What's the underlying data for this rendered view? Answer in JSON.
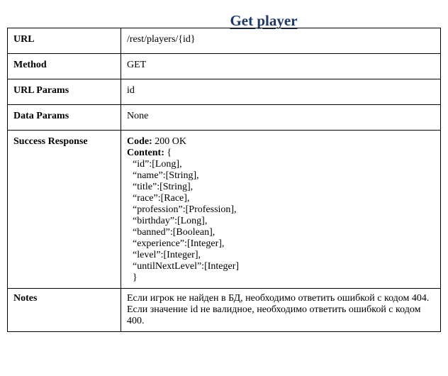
{
  "title": "Get player",
  "rows": {
    "url": {
      "key": "URL",
      "value": "/rest/players/{id}"
    },
    "method": {
      "key": "Method",
      "value": "GET"
    },
    "url_params": {
      "key": "URL Params",
      "value": "id"
    },
    "data_params": {
      "key": "Data Params",
      "value": "None"
    },
    "success": {
      "key": "Success Response",
      "code_label": "Code:",
      "code_value": " 200 OK",
      "content_label": "Content:",
      "content_open": " {",
      "fields": [
        "“id”:[Long],",
        "“name”:[String],",
        "“title”:[String],",
        "“race”:[Race],",
        "“profession”:[Profession],",
        "“birthday”:[Long],",
        "“banned”:[Boolean],",
        "“experience”:[Integer],",
        "“level”:[Integer],",
        "“untilNextLevel”:[Integer]"
      ],
      "content_close": "}"
    },
    "notes": {
      "key": "Notes",
      "lines": [
        "Если игрок не найден в БД, необходимо ответить ошибкой с кодом 404.",
        "Если значение id не валидное, необходимо ответить ошибкой с кодом 400."
      ]
    }
  }
}
